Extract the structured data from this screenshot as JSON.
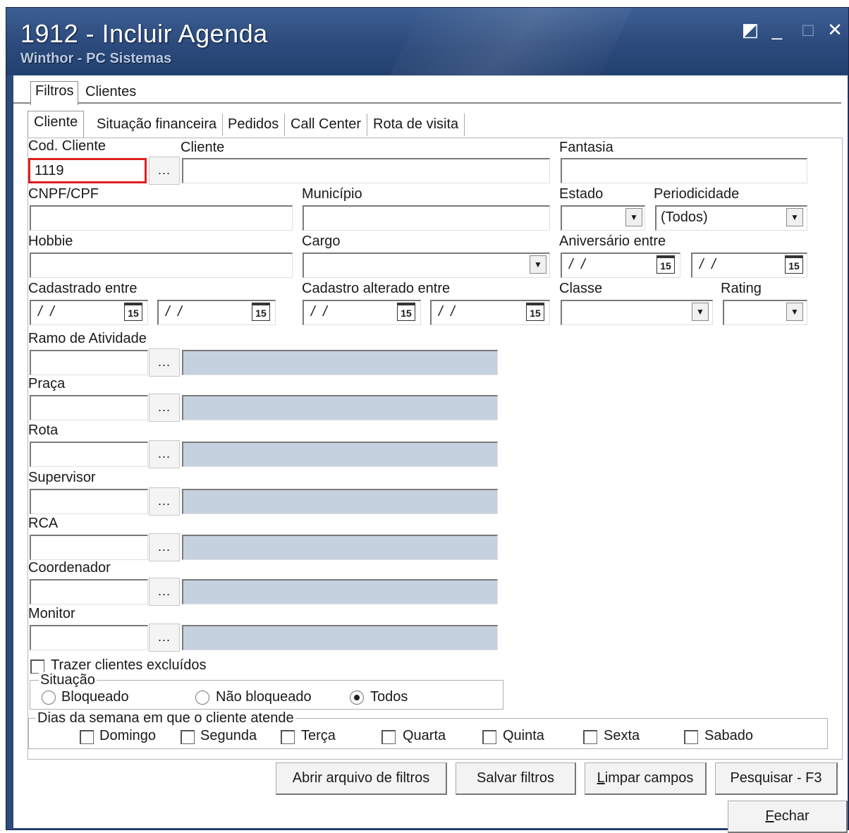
{
  "window": {
    "title": "1912 - Incluir Agenda",
    "subtitle": "Winthor - PC Sistemas",
    "controls": {
      "restore": "◩",
      "minimize": "_",
      "maximize": "□",
      "close": "✕"
    }
  },
  "outer_tabs": [
    "Filtros",
    "Clientes"
  ],
  "inner_tabs": [
    "Cliente",
    "Situação financeira",
    "Pedidos",
    "Call Center",
    "Rota de visita"
  ],
  "fields": {
    "cod_cliente": {
      "label": "Cod. Cliente",
      "value": "1119"
    },
    "cliente": {
      "label": "Cliente",
      "value": ""
    },
    "fantasia": {
      "label": "Fantasia",
      "value": ""
    },
    "cnpf_cpf": {
      "label": "CNPF/CPF",
      "value": ""
    },
    "municipio": {
      "label": "Município",
      "value": ""
    },
    "estado": {
      "label": "Estado",
      "value": ""
    },
    "periodicidade": {
      "label": "Periodicidade",
      "value": "(Todos)"
    },
    "hobbie": {
      "label": "Hobbie",
      "value": ""
    },
    "cargo": {
      "label": "Cargo",
      "value": ""
    },
    "aniversario": {
      "label": "Aniversário entre",
      "from": "/ /",
      "to": "/ /"
    },
    "cadastrado": {
      "label": "Cadastrado entre",
      "from": "/ /",
      "to": "/ /"
    },
    "cadastro_alterado": {
      "label": "Cadastro alterado entre",
      "from": "/ /",
      "to": "/ /"
    },
    "classe": {
      "label": "Classe",
      "value": ""
    },
    "rating": {
      "label": "Rating",
      "value": ""
    },
    "ramo_atividade": {
      "label": "Ramo de Atividade"
    },
    "praca": {
      "label": "Praça"
    },
    "rota": {
      "label": "Rota"
    },
    "supervisor": {
      "label": "Supervisor"
    },
    "rca": {
      "label": "RCA"
    },
    "coordenador": {
      "label": "Coordenador"
    },
    "monitor": {
      "label": "Monitor"
    }
  },
  "lookup_button": "...",
  "calendar_icon": "15",
  "dropdown_glyph": "▼",
  "trazer_excluidos": "Trazer clientes excluídos",
  "situacao": {
    "title": "Situação",
    "options": [
      "Bloqueado",
      "Não bloqueado",
      "Todos"
    ],
    "selected": "Todos"
  },
  "dias_semana": {
    "title": "Dias da semana em que o cliente atende",
    "days": [
      "Domingo",
      "Segunda",
      "Terça",
      "Quarta",
      "Quinta",
      "Sexta",
      "Sabado"
    ]
  },
  "buttons": {
    "abrir": "Abrir arquivo de filtros",
    "salvar": "Salvar filtros",
    "limpar_first": "L",
    "limpar_rest": "impar campos",
    "pesquisar": "Pesquisar - F3",
    "fechar_first": "F",
    "fechar_rest": "echar"
  },
  "colors": {
    "titlebar": "#2c4a7c",
    "readonly_field": "#c6d1df",
    "highlight": "#e02020"
  }
}
